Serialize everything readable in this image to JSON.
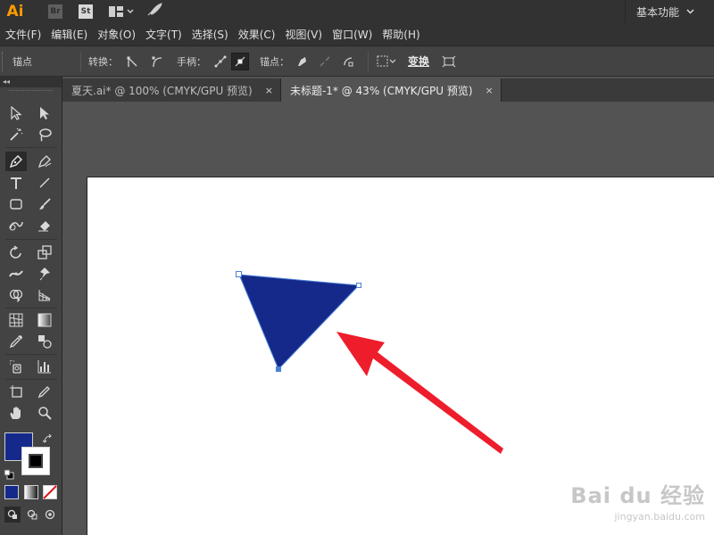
{
  "app": {
    "logo": "Ai",
    "bridge_label": "Br",
    "stock_label": "St",
    "workspace_label": "基本功能"
  },
  "menu": [
    "文件(F)",
    "编辑(E)",
    "对象(O)",
    "文字(T)",
    "选择(S)",
    "效果(C)",
    "视图(V)",
    "窗口(W)",
    "帮助(H)"
  ],
  "control_bar": {
    "anchor_label": "锚点",
    "convert_label": "转换：",
    "handles_label": "手柄：",
    "anchors_label": "锚点：",
    "transform_label": "变换"
  },
  "tabs": [
    {
      "label": "夏天.ai* @ 100% (CMYK/GPU 预览)",
      "close": "×"
    },
    {
      "label": "未标题-1* @ 43% (CMYK/GPU 预览)",
      "close": "×"
    }
  ],
  "colors": {
    "fill": "#15298a",
    "stroke": "#000000",
    "arrow": "#ee1d2b",
    "selection": "#4a7fd6"
  },
  "toolbar": {
    "collapse_label": "◂◂"
  },
  "watermark": {
    "brand": "Bai du 经验",
    "url": "jingyan.baidu.com"
  }
}
